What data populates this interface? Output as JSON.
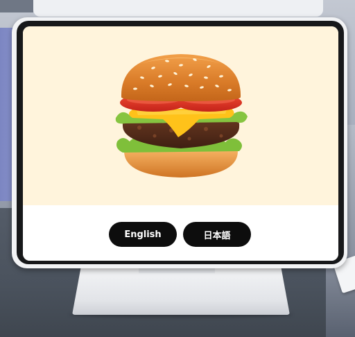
{
  "kiosk": {
    "hero_image": "hamburger-image",
    "language_buttons": [
      {
        "label": "English"
      },
      {
        "label": "日本語"
      }
    ]
  },
  "colors": {
    "hero_background": "#fff4dc",
    "button_background": "#0d0d0d",
    "button_text": "#ffffff",
    "bezel": "#17181a"
  }
}
